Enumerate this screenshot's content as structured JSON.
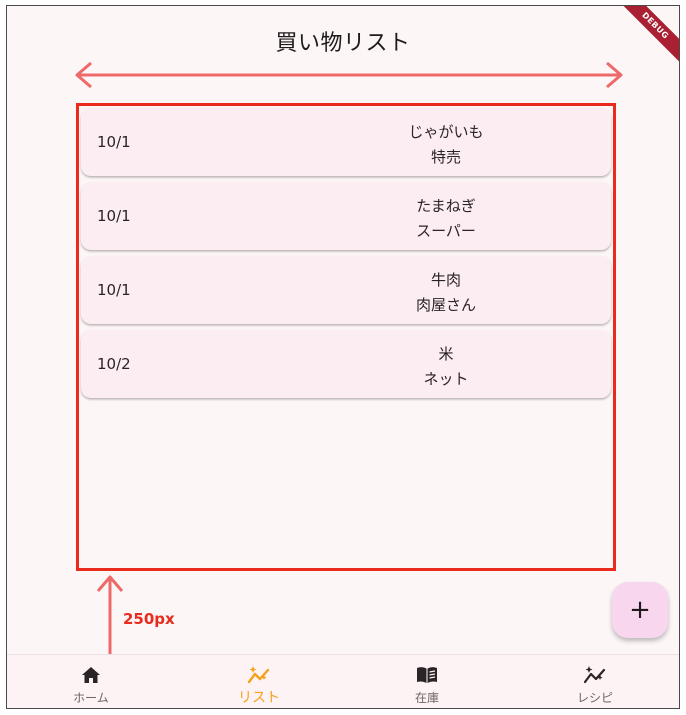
{
  "app": {
    "title": "買い物リスト",
    "debug_banner": "DEBUG"
  },
  "list": {
    "items": [
      {
        "date": "10/1",
        "name": "じゃがいも",
        "store": "特売"
      },
      {
        "date": "10/1",
        "name": "たまねぎ",
        "store": "スーパー"
      },
      {
        "date": "10/1",
        "name": "牛肉",
        "store": "肉屋さん"
      },
      {
        "date": "10/2",
        "name": "米",
        "store": "ネット"
      }
    ]
  },
  "annotations": {
    "height_label": "250px",
    "arrow_color": "#ee6a6a",
    "box_color": "#ea2a1c"
  },
  "fab": {
    "label": "+",
    "icon": "plus-icon"
  },
  "bottom_nav": {
    "items": [
      {
        "label": "ホーム",
        "icon": "home-icon",
        "active": false
      },
      {
        "label": "リスト",
        "icon": "sparkle-chart-icon",
        "active": true
      },
      {
        "label": "在庫",
        "icon": "book-icon",
        "active": false
      },
      {
        "label": "レシピ",
        "icon": "sparkle-chart-icon",
        "active": false
      }
    ],
    "active_color": "#f5a11c"
  }
}
